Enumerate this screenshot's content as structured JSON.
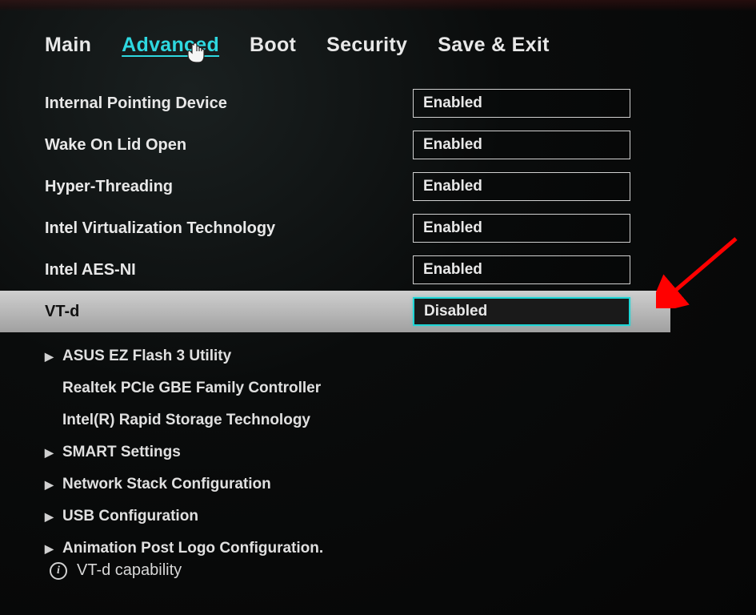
{
  "tabs": {
    "main": "Main",
    "advanced": "Advanced",
    "boot": "Boot",
    "security": "Security",
    "saveexit": "Save & Exit"
  },
  "settings": [
    {
      "label": "Internal Pointing Device",
      "value": "Enabled",
      "selected": false
    },
    {
      "label": "Wake On Lid Open",
      "value": "Enabled",
      "selected": false
    },
    {
      "label": "Hyper-Threading",
      "value": "Enabled",
      "selected": false
    },
    {
      "label": "Intel Virtualization Technology",
      "value": "Enabled",
      "selected": false
    },
    {
      "label": "Intel AES-NI",
      "value": "Enabled",
      "selected": false
    },
    {
      "label": "VT-d",
      "value": "Disabled",
      "selected": true
    }
  ],
  "submenus": [
    {
      "label": "ASUS EZ Flash 3 Utility",
      "chev": true
    },
    {
      "label": "Realtek PCIe GBE Family Controller",
      "chev": false
    },
    {
      "label": "Intel(R) Rapid Storage Technology",
      "chev": false
    },
    {
      "label": "SMART Settings",
      "chev": true
    },
    {
      "label": "Network Stack Configuration",
      "chev": true
    },
    {
      "label": "USB Configuration",
      "chev": true
    },
    {
      "label": "Animation Post Logo Configuration.",
      "chev": true
    }
  ],
  "help": {
    "text": "VT-d capability"
  }
}
